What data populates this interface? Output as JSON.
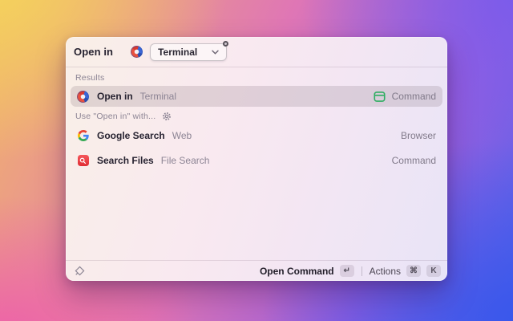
{
  "header": {
    "command_label": "Open in",
    "dropdown_value": "Terminal"
  },
  "results_section": {
    "label": "Results"
  },
  "results": [
    {
      "title": "Open in",
      "subtitle": "Terminal",
      "accessory": "Command"
    }
  ],
  "use_with_section": {
    "label": "Use \"Open in\" with..."
  },
  "use_with_items": [
    {
      "title": "Google Search",
      "subtitle": "Web",
      "accessory": "Browser"
    },
    {
      "title": "Search Files",
      "subtitle": "File Search",
      "accessory": "Command"
    }
  ],
  "footer": {
    "primary_label": "Open Command",
    "primary_key": "↵",
    "actions_label": "Actions",
    "key_cmd": "⌘",
    "key_k": "K"
  },
  "icons": {
    "open_in_extension": "multicolor-circle-icon",
    "dropdown_chevron": "chevron-down-icon",
    "dropdown_badge": "notification-dot",
    "gear": "gear-icon",
    "google": "google-g-logo-icon",
    "search_files": "red-square-magnifier-icon",
    "command_accessory": "green-window-outline-icon",
    "raycast_logo": "diamond-outline-logo-icon"
  },
  "colors": {
    "accent_green": "#2fae62",
    "search_files_red": "#e02d35",
    "google_blue": "#4285F4",
    "google_red": "#EA4335",
    "google_yellow": "#FBBC05",
    "google_green": "#34A853",
    "title_text": "#262230",
    "secondary_text": "#8c8494",
    "selected_row_bg": "rgba(92,74,88,0.16)"
  }
}
